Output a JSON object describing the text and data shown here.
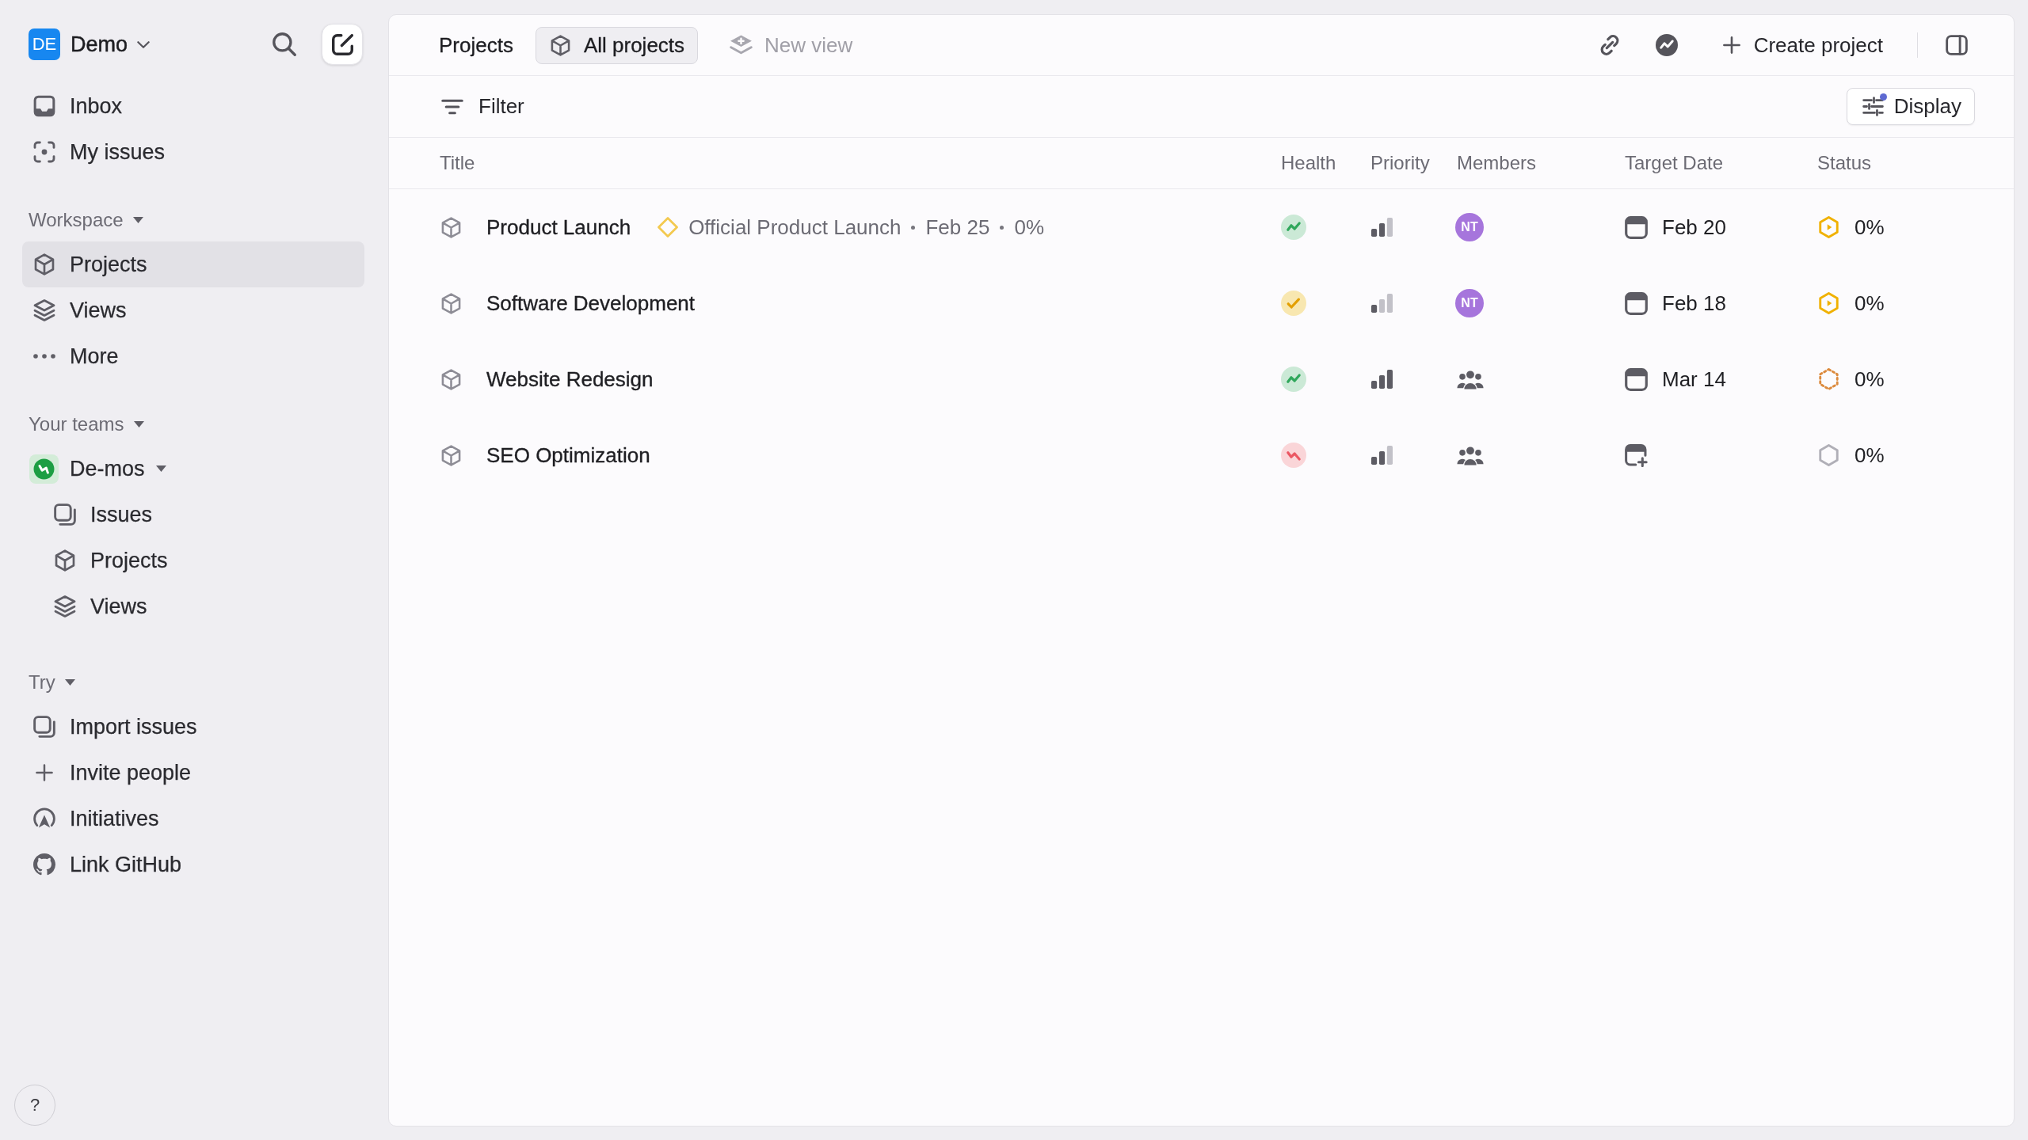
{
  "sidebar": {
    "workspace": {
      "initials": "DE",
      "name": "Demo"
    },
    "nav": [
      {
        "kind": "inbox",
        "label": "Inbox",
        "selected": false
      },
      {
        "kind": "my_issues",
        "label": "My issues",
        "selected": false
      }
    ],
    "sections": [
      {
        "title": "Workspace",
        "expanded": true,
        "items": [
          {
            "kind": "projects",
            "label": "Projects",
            "selected": true
          },
          {
            "kind": "views",
            "label": "Views",
            "selected": false
          },
          {
            "kind": "more",
            "label": "More",
            "selected": false
          }
        ]
      },
      {
        "title": "Your teams",
        "expanded": true,
        "teams": [
          {
            "name": "De-mos",
            "expanded": true,
            "children": [
              {
                "kind": "issues",
                "label": "Issues",
                "selected": false
              },
              {
                "kind": "projects",
                "label": "Projects",
                "selected": false
              },
              {
                "kind": "views",
                "label": "Views",
                "selected": false
              }
            ]
          }
        ]
      },
      {
        "title": "Try",
        "expanded": true,
        "items": [
          {
            "kind": "import",
            "label": "Import issues",
            "selected": false
          },
          {
            "kind": "invite",
            "label": "Invite people",
            "selected": false
          },
          {
            "kind": "initiatives",
            "label": "Initiatives",
            "selected": false
          },
          {
            "kind": "github",
            "label": "Link GitHub",
            "selected": false
          }
        ]
      }
    ],
    "help": {
      "label": "?"
    }
  },
  "main": {
    "header": {
      "title": "Projects",
      "tabs": [
        {
          "label": "All projects",
          "selected": true
        }
      ],
      "new_view": {
        "label": "New view"
      },
      "create": {
        "label": "Create project"
      }
    },
    "toolbar": {
      "filter": {
        "label": "Filter"
      },
      "display": {
        "label": "Display",
        "modified": true
      }
    },
    "table": {
      "columns": [
        "Title",
        "Health",
        "Priority",
        "Members",
        "Target Date",
        "Status"
      ],
      "rows": [
        {
          "title": "Product Launch",
          "milestone": {
            "name": "Official Product Launch",
            "date": "Feb 25",
            "progress": "0%"
          },
          "health": {
            "kind": "on_track",
            "color": "#cbe9d6"
          },
          "priority": {
            "kind": "medium"
          },
          "members": {
            "kind": "avatar",
            "initials": "NT"
          },
          "target_date": "Feb 20",
          "status": {
            "kind": "in_progress",
            "color": "#f0b100"
          },
          "progress": "0%"
        },
        {
          "title": "Software Development",
          "health": {
            "kind": "at_risk",
            "color": "#f8e7b0"
          },
          "priority": {
            "kind": "low"
          },
          "members": {
            "kind": "avatar",
            "initials": "NT"
          },
          "target_date": "Feb 18",
          "status": {
            "kind": "in_progress",
            "color": "#f0b100"
          },
          "progress": "0%"
        },
        {
          "title": "Website Redesign",
          "health": {
            "kind": "on_track",
            "color": "#cbe9d6"
          },
          "priority": {
            "kind": "high"
          },
          "members": {
            "kind": "empty"
          },
          "target_date": "Mar 14",
          "status": {
            "kind": "backlog",
            "color": "#dc8a3c"
          },
          "progress": "0%"
        },
        {
          "title": "SEO Optimization",
          "health": {
            "kind": "off_track",
            "color": "#fad5d8"
          },
          "priority": {
            "kind": "medium"
          },
          "members": {
            "kind": "empty"
          },
          "status": {
            "kind": "planned",
            "color": "#b0afb7"
          },
          "progress": "0%"
        }
      ]
    }
  }
}
